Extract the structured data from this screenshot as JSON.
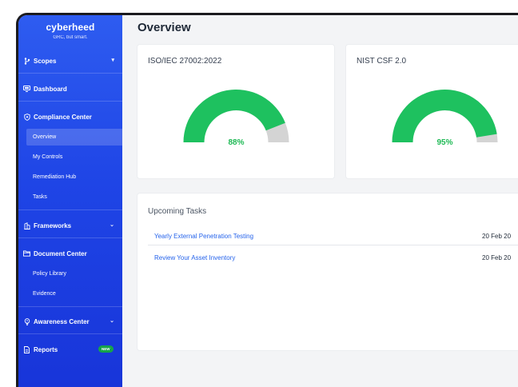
{
  "brand": {
    "name": "cyberheed",
    "tagline": "GRC, but smart."
  },
  "sidebar": {
    "scopes": "Scopes",
    "dashboard": "Dashboard",
    "compliance_center": "Compliance Center",
    "compliance_items": [
      "Overview",
      "My Controls",
      "Remediation Hub",
      "Tasks"
    ],
    "frameworks": "Frameworks",
    "document_center": "Document Center",
    "document_items": [
      "Policy Library",
      "Evidence"
    ],
    "awareness_center": "Awareness Center",
    "reports": "Reports",
    "reports_badge": "NEW",
    "active_item": "Overview"
  },
  "main": {
    "title": "Overview",
    "frameworks": [
      {
        "name": "ISO/IEC 27002:2022",
        "percent_label": "88%",
        "percent": 88
      },
      {
        "name": "NIST CSF 2.0",
        "percent_label": "95%",
        "percent": 95
      }
    ],
    "tasks": {
      "title": "Upcoming Tasks",
      "rows": [
        {
          "name": "Yearly External Penetration Testing",
          "date": "20 Feb 20"
        },
        {
          "name": "Review Your Asset Inventory",
          "date": "20 Feb 20"
        }
      ]
    }
  },
  "colors": {
    "sidebar_top": "#2e5cf0",
    "sidebar_bottom": "#1835d9",
    "gauge_fill": "#1ec15f",
    "gauge_track": "#d4d4d4",
    "link": "#2563eb",
    "badge": "#16a34a"
  }
}
